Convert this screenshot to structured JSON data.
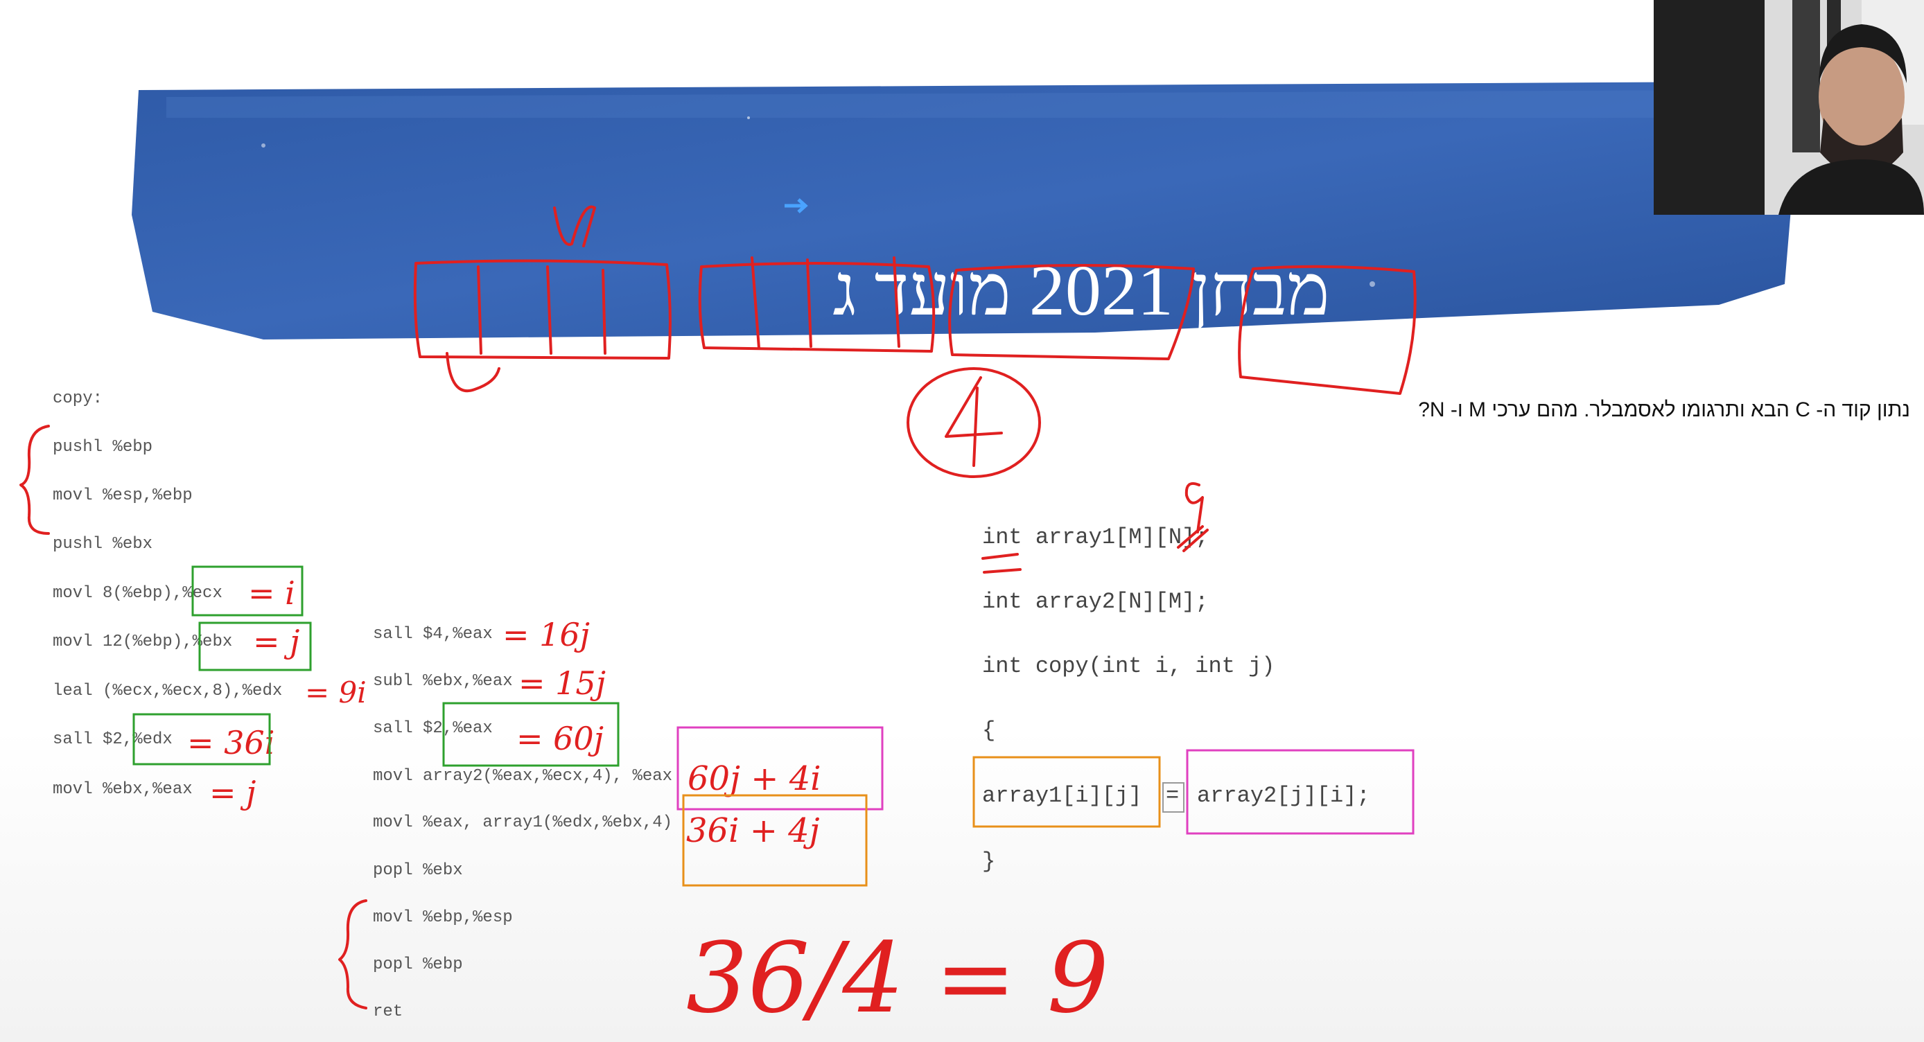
{
  "slide": {
    "title": "מבחן 2021 מועד ג",
    "question": "נתון קוד ה- C הבא ותרגומו לאסמבלר. מהם ערכי M ו- N?"
  },
  "assembly_left": [
    "copy:",
    "pushl %ebp",
    "movl %esp,%ebp",
    "pushl %ebx",
    "movl 8(%ebp),%ecx",
    "movl 12(%ebp),%ebx",
    "leal (%ecx,%ecx,8),%edx",
    "sall $2,%edx",
    "movl %ebx,%eax"
  ],
  "assembly_right": [
    "sall $4,%eax",
    "subl %ebx,%eax",
    "sall $2,%eax",
    "movl array2(%eax,%ecx,4), %eax",
    "movl %eax, array1(%edx,%ebx,4)",
    "popl %ebx",
    "movl %ebp,%esp",
    "popl %ebp",
    "ret"
  ],
  "c_code": {
    "line1": "int array1[M][N];",
    "line2": "int array2[N][M];",
    "line3": "int copy(int i, int j)",
    "line4": "{",
    "line5_left": "array1[i][j]",
    "line5_eq": "=",
    "line5_right": "array2[j][i];",
    "line6": "}"
  },
  "annotations": {
    "ecx": "= i",
    "ebx": "= j",
    "edx_lea": "= 9i",
    "edx_sall": "= 36i",
    "eax_mov": "= j",
    "eax_sall4": "= 16j",
    "eax_subl": "= 15j",
    "eax_sall2": "= 60j",
    "magenta_box": "60j + 4i",
    "orange_box": "36i + 4j",
    "formula": "36/4 = 9",
    "circled": "4",
    "top_m": "M",
    "nine_above": "9"
  },
  "colors": {
    "banner": "#3a66b5",
    "ink_red": "#e02020",
    "green_box": "#2ea02e",
    "magenta_box": "#e040c0",
    "orange_box": "#e8901a"
  }
}
